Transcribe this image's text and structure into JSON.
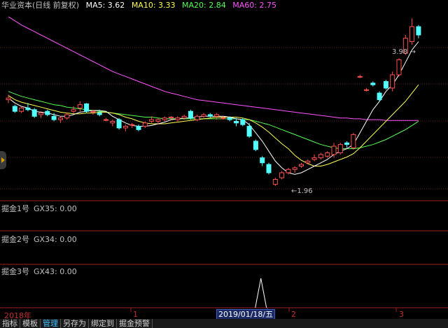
{
  "legend": {
    "title": "华业资本(日线 前复权)",
    "ma5": "MA5: 3.62",
    "ma10": "MA10: 3.33",
    "ma20": "MA20: 2.84",
    "ma60": "MA60: 2.75"
  },
  "colors": {
    "up": "#ff5050",
    "down": "#54ffff",
    "ma5": "#ffffff",
    "ma10": "#ffff54",
    "ma20": "#54ff54",
    "ma60": "#ff54ff",
    "panel_line": "#ff8080"
  },
  "price_labels": {
    "high": "3.98",
    "low": "1.96"
  },
  "indicators": [
    {
      "name": "掘金1号",
      "value": "GX35: 0.00"
    },
    {
      "name": "掘金2号",
      "value": "GX34: 0.00"
    },
    {
      "name": "掘金3号",
      "value": "GX43: 0.00"
    }
  ],
  "time_axis": {
    "start": "2018年",
    "m1": "1",
    "m2": "2",
    "m3": "3",
    "selected_date": "2019/01/18/五"
  },
  "toolbar": [
    "指标",
    "模板",
    "管理",
    "另存为",
    "绑定到",
    "掘金预警"
  ],
  "chart_data": {
    "type": "candlestick",
    "ylim": [
      1.8,
      4.1
    ],
    "candles": [
      [
        3.0,
        3.06,
        2.96,
        3.02
      ],
      [
        2.92,
        2.94,
        2.84,
        2.86
      ],
      [
        2.86,
        2.92,
        2.84,
        2.9
      ],
      [
        2.9,
        2.96,
        2.86,
        2.88
      ],
      [
        2.88,
        2.9,
        2.78,
        2.8
      ],
      [
        2.82,
        2.86,
        2.78,
        2.84
      ],
      [
        2.86,
        2.88,
        2.8,
        2.82
      ],
      [
        2.8,
        2.84,
        2.74,
        2.76
      ],
      [
        2.76,
        2.8,
        2.72,
        2.78
      ],
      [
        2.78,
        2.84,
        2.76,
        2.82
      ],
      [
        2.86,
        2.92,
        2.84,
        2.88
      ],
      [
        2.9,
        2.98,
        2.86,
        2.94
      ],
      [
        2.95,
        2.96,
        2.84,
        2.86
      ],
      [
        2.85,
        2.88,
        2.82,
        2.86
      ],
      [
        2.84,
        2.88,
        2.8,
        2.82
      ],
      [
        2.76,
        2.78,
        2.74,
        2.76
      ],
      [
        2.72,
        2.76,
        2.68,
        2.74
      ],
      [
        2.76,
        2.78,
        2.64,
        2.66
      ],
      [
        2.66,
        2.7,
        2.62,
        2.68
      ],
      [
        2.7,
        2.72,
        2.66,
        2.7
      ],
      [
        2.68,
        2.7,
        2.62,
        2.64
      ],
      [
        2.68,
        2.74,
        2.66,
        2.72
      ],
      [
        2.74,
        2.8,
        2.72,
        2.76
      ],
      [
        2.74,
        2.78,
        2.7,
        2.76
      ],
      [
        2.76,
        2.8,
        2.74,
        2.78
      ],
      [
        2.78,
        2.8,
        2.76,
        2.79
      ],
      [
        2.76,
        2.8,
        2.74,
        2.78
      ],
      [
        2.78,
        2.82,
        2.76,
        2.8
      ],
      [
        2.86,
        2.88,
        2.76,
        2.78
      ],
      [
        2.76,
        2.82,
        2.74,
        2.8
      ],
      [
        2.8,
        2.84,
        2.78,
        2.82
      ],
      [
        2.82,
        2.84,
        2.78,
        2.8
      ],
      [
        2.8,
        2.84,
        2.76,
        2.82
      ],
      [
        2.78,
        2.8,
        2.76,
        2.78
      ],
      [
        2.78,
        2.8,
        2.74,
        2.76
      ],
      [
        2.74,
        2.78,
        2.68,
        2.72
      ],
      [
        2.76,
        2.78,
        2.68,
        2.7
      ],
      [
        2.68,
        2.72,
        2.54,
        2.56
      ],
      [
        2.5,
        2.52,
        2.38,
        2.4
      ],
      [
        2.3,
        2.32,
        2.2,
        2.24
      ],
      [
        2.22,
        2.24,
        2.1,
        2.12
      ],
      [
        1.98,
        2.06,
        1.96,
        2.04
      ],
      [
        2.06,
        2.14,
        2.04,
        2.12
      ],
      [
        2.12,
        2.18,
        2.1,
        2.16
      ],
      [
        2.16,
        2.2,
        2.12,
        2.18
      ],
      [
        2.2,
        2.24,
        2.18,
        2.22
      ],
      [
        2.24,
        2.28,
        2.22,
        2.26
      ],
      [
        2.28,
        2.34,
        2.26,
        2.3
      ],
      [
        2.3,
        2.36,
        2.28,
        2.34
      ],
      [
        2.32,
        2.38,
        2.3,
        2.36
      ],
      [
        2.34,
        2.48,
        2.3,
        2.44
      ],
      [
        2.36,
        2.48,
        2.34,
        2.46
      ],
      [
        2.48,
        2.5,
        2.42,
        2.46
      ],
      [
        2.42,
        2.6,
        2.4,
        2.58
      ],
      [
        3.28,
        3.3,
        3.26,
        3.28
      ],
      [
        3.12,
        3.14,
        3.1,
        3.12
      ],
      [
        3.2,
        3.22,
        3.16,
        3.18
      ],
      [
        3.08,
        3.1,
        2.98,
        3.0
      ],
      [
        3.22,
        3.24,
        3.12,
        3.14
      ],
      [
        3.14,
        3.34,
        3.1,
        3.3
      ],
      [
        3.3,
        3.5,
        3.28,
        3.48
      ],
      [
        3.56,
        3.78,
        3.54,
        3.74
      ],
      [
        3.7,
        3.98,
        3.66,
        3.88
      ],
      [
        3.88,
        3.9,
        3.74,
        3.78
      ]
    ],
    "ma5": [
      3.02,
      2.96,
      2.92,
      2.9,
      2.86,
      2.85,
      2.84,
      2.82,
      2.8,
      2.8,
      2.82,
      2.85,
      2.86,
      2.87,
      2.87,
      2.86,
      2.8,
      2.76,
      2.72,
      2.69,
      2.68,
      2.68,
      2.69,
      2.71,
      2.73,
      2.76,
      2.77,
      2.78,
      2.78,
      2.79,
      2.8,
      2.8,
      2.8,
      2.8,
      2.79,
      2.77,
      2.76,
      2.7,
      2.6,
      2.5,
      2.38,
      2.26,
      2.18,
      2.12,
      2.1,
      2.12,
      2.16,
      2.2,
      2.24,
      2.28,
      2.34,
      2.38,
      2.41,
      2.46,
      2.6,
      2.74,
      2.88,
      2.98,
      3.1,
      3.18,
      3.3,
      3.45,
      3.6,
      3.7
    ],
    "ma10": [
      3.05,
      3.0,
      2.97,
      2.95,
      2.93,
      2.91,
      2.89,
      2.87,
      2.85,
      2.84,
      2.83,
      2.83,
      2.84,
      2.84,
      2.85,
      2.85,
      2.84,
      2.82,
      2.79,
      2.77,
      2.74,
      2.72,
      2.71,
      2.71,
      2.71,
      2.72,
      2.73,
      2.74,
      2.75,
      2.76,
      2.77,
      2.78,
      2.79,
      2.79,
      2.79,
      2.79,
      2.78,
      2.76,
      2.72,
      2.67,
      2.61,
      2.54,
      2.47,
      2.41,
      2.33,
      2.27,
      2.23,
      2.2,
      2.2,
      2.22,
      2.25,
      2.28,
      2.31,
      2.35,
      2.42,
      2.5,
      2.58,
      2.66,
      2.74,
      2.82,
      2.9,
      2.98,
      3.08,
      3.18
    ],
    "ma20": [
      3.1,
      3.07,
      3.04,
      3.02,
      3.0,
      2.98,
      2.96,
      2.94,
      2.93,
      2.91,
      2.9,
      2.89,
      2.88,
      2.87,
      2.86,
      2.85,
      2.84,
      2.83,
      2.82,
      2.81,
      2.8,
      2.79,
      2.79,
      2.78,
      2.77,
      2.77,
      2.77,
      2.77,
      2.77,
      2.77,
      2.77,
      2.77,
      2.77,
      2.77,
      2.77,
      2.77,
      2.76,
      2.76,
      2.74,
      2.72,
      2.7,
      2.67,
      2.64,
      2.61,
      2.58,
      2.55,
      2.52,
      2.49,
      2.46,
      2.44,
      2.42,
      2.41,
      2.41,
      2.41,
      2.42,
      2.44,
      2.46,
      2.49,
      2.52,
      2.56,
      2.6,
      2.64,
      2.69,
      2.74
    ],
    "ma60": [
      4.0,
      3.95,
      3.9,
      3.86,
      3.82,
      3.78,
      3.74,
      3.7,
      3.66,
      3.62,
      3.58,
      3.54,
      3.5,
      3.46,
      3.42,
      3.38,
      3.34,
      3.31,
      3.28,
      3.25,
      3.22,
      3.19,
      3.16,
      3.13,
      3.1,
      3.08,
      3.06,
      3.04,
      3.02,
      3.0,
      2.99,
      2.98,
      2.97,
      2.96,
      2.95,
      2.94,
      2.93,
      2.92,
      2.91,
      2.9,
      2.89,
      2.88,
      2.87,
      2.86,
      2.85,
      2.84,
      2.83,
      2.82,
      2.81,
      2.8,
      2.79,
      2.78,
      2.78,
      2.77,
      2.77,
      2.76,
      2.76,
      2.76,
      2.75,
      2.75,
      2.75,
      2.75,
      2.75,
      2.75
    ],
    "gx43_spike_index": 39
  }
}
